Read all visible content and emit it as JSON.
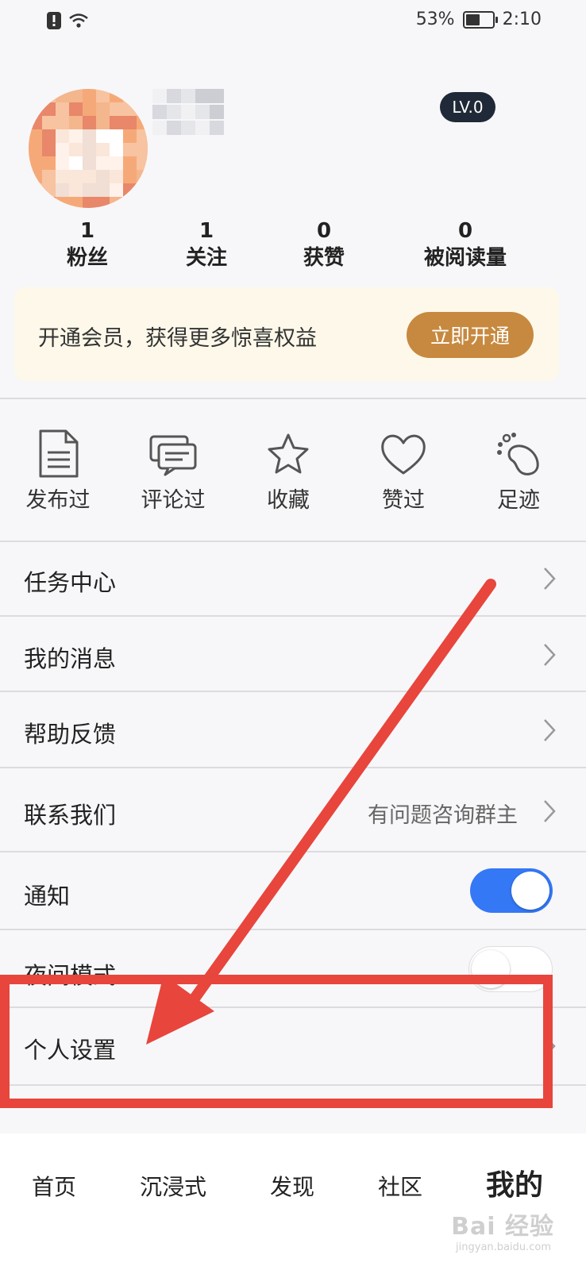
{
  "status": {
    "battery": "53%",
    "time": "2:10",
    "battery_level": 0.53
  },
  "profile": {
    "level": "LV.0"
  },
  "stats": [
    {
      "value": "1",
      "label": "粉丝"
    },
    {
      "value": "1",
      "label": "关注"
    },
    {
      "value": "0",
      "label": "获赞"
    },
    {
      "value": "0",
      "label": "被阅读量"
    }
  ],
  "vip": {
    "text": "开通会员，获得更多惊喜权益",
    "button": "立即开通"
  },
  "quick": [
    {
      "label": "发布过",
      "icon": "document-icon"
    },
    {
      "label": "评论过",
      "icon": "comment-icon"
    },
    {
      "label": "收藏",
      "icon": "star-icon"
    },
    {
      "label": "赞过",
      "icon": "heart-icon"
    },
    {
      "label": "足迹",
      "icon": "footprint-icon"
    }
  ],
  "menu": {
    "task_center": "任务中心",
    "messages": "我的消息",
    "help": "帮助反馈",
    "contact": "联系我们",
    "contact_hint": "有问题咨询群主",
    "notify": "通知",
    "notify_on": true,
    "night": "夜间模式",
    "night_on": false,
    "settings": "个人设置"
  },
  "nav": {
    "home": "首页",
    "immersive": "沉浸式",
    "discover": "发现",
    "community": "社区",
    "mine": "我的"
  },
  "watermark": {
    "text": "Bai 经验",
    "sub": "jingyan.baidu.com"
  },
  "colors": {
    "accent": "#3478f6",
    "vip_button": "#c7893f",
    "annotation": "#e8453c"
  }
}
